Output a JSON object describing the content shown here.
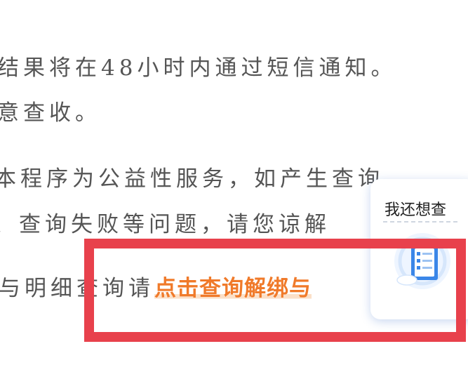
{
  "content": {
    "line1": "结果将在48小时内通过短信通知。",
    "line2": "意查收。",
    "line3": "本程序为公益性服务，如产生查询",
    "line4": "、查询失败等问题，请您谅解",
    "line5_prefix": "与明细查询请",
    "line5_link": "点击查询解绑与"
  },
  "floating_card": {
    "title": "我还想查",
    "icon": "checklist-document-icon"
  },
  "colors": {
    "body_text": "#555555",
    "link": "#f07a2a",
    "highlight_border": "#e8414c",
    "card_accent": "#3a86e8"
  }
}
